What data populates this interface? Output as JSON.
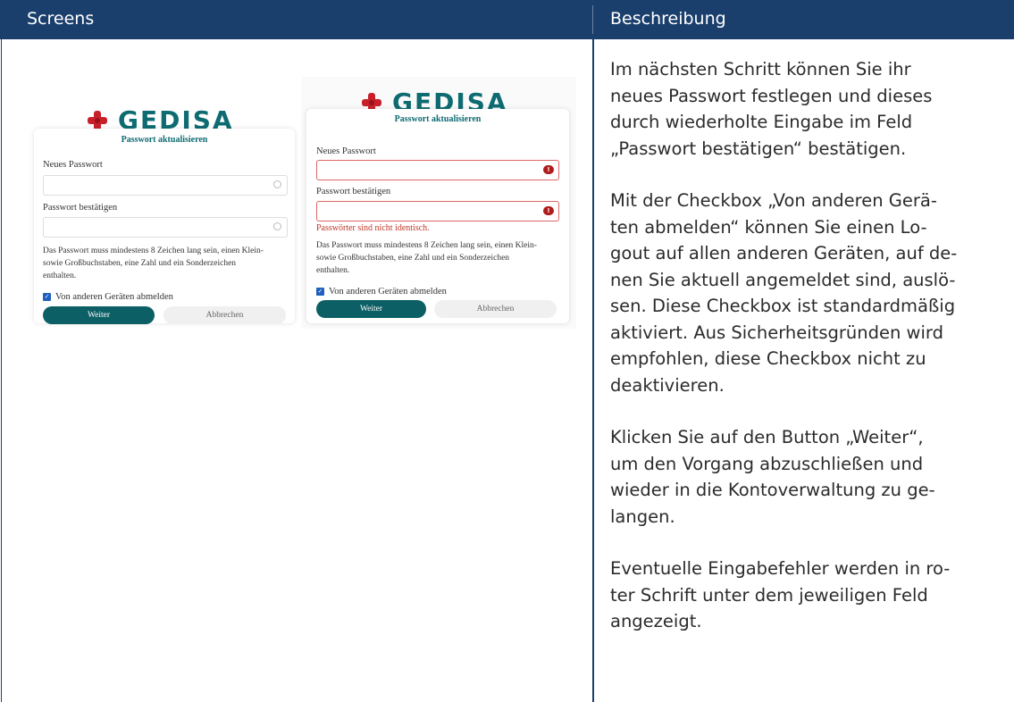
{
  "header": {
    "left_title": "Screens",
    "right_title": "Beschreibung"
  },
  "brand": {
    "logo_text": "GEDISA",
    "primary_color": "#0d5f66",
    "accent_color": "#c8202a"
  },
  "screen1": {
    "card_title": "Passwort aktualisieren",
    "new_password_label": "Neues Passwort",
    "confirm_password_label": "Passwort bestätigen",
    "hint": "Das Passwort muss mindestens 8 Zeichen lang sein, einen Klein-\nsowie Großbuchstaben, eine Zahl und ein Sonderzeichen\nenthalten.",
    "checkbox_label": "Von anderen Geräten abmelden",
    "checkbox_checked": true,
    "continue_button": "Weiter",
    "cancel_button": "Abbrechen"
  },
  "screen2": {
    "card_title": "Passwort aktualisieren",
    "new_password_label": "Neues Passwort",
    "confirm_password_label": "Passwort bestätigen",
    "error_message": "Passwörter sind nicht identisch.",
    "hint": "Das Passwort muss mindestens 8 Zeichen lang sein, einen Klein-\nsowie Großbuchstaben, eine Zahl und ein Sonderzeichen\nenthalten.",
    "checkbox_label": "Von anderen Geräten abmelden",
    "checkbox_checked": true,
    "continue_button": "Weiter",
    "cancel_button": "Abbrechen"
  },
  "description": {
    "p1": "Im nächsten Schritt können Sie ihr\nneues Passwort festlegen und dieses\ndurch wiederholte Eingabe im Feld\n„Passwort bestätigen“ bestätigen.",
    "p2": "Mit der Checkbox „Von anderen Gerä-\nten abmelden“ können Sie einen Lo-\ngout auf allen anderen Geräten, auf de-\nnen Sie aktuell angemeldet sind, auslö-\nsen. Diese Checkbox ist standardmäßig\naktiviert. Aus Sicherheitsgründen wird\nempfohlen, diese Checkbox nicht zu\ndeaktivieren.",
    "p3": "Klicken Sie auf den Button „Weiter“,\num den Vorgang abzuschließen und\nwieder in die Kontoverwaltung zu ge-\nlangen.",
    "p4": "Eventuelle Eingabefehler werden in ro-\nter Schrift unter dem jeweiligen Feld\nangezeigt."
  }
}
